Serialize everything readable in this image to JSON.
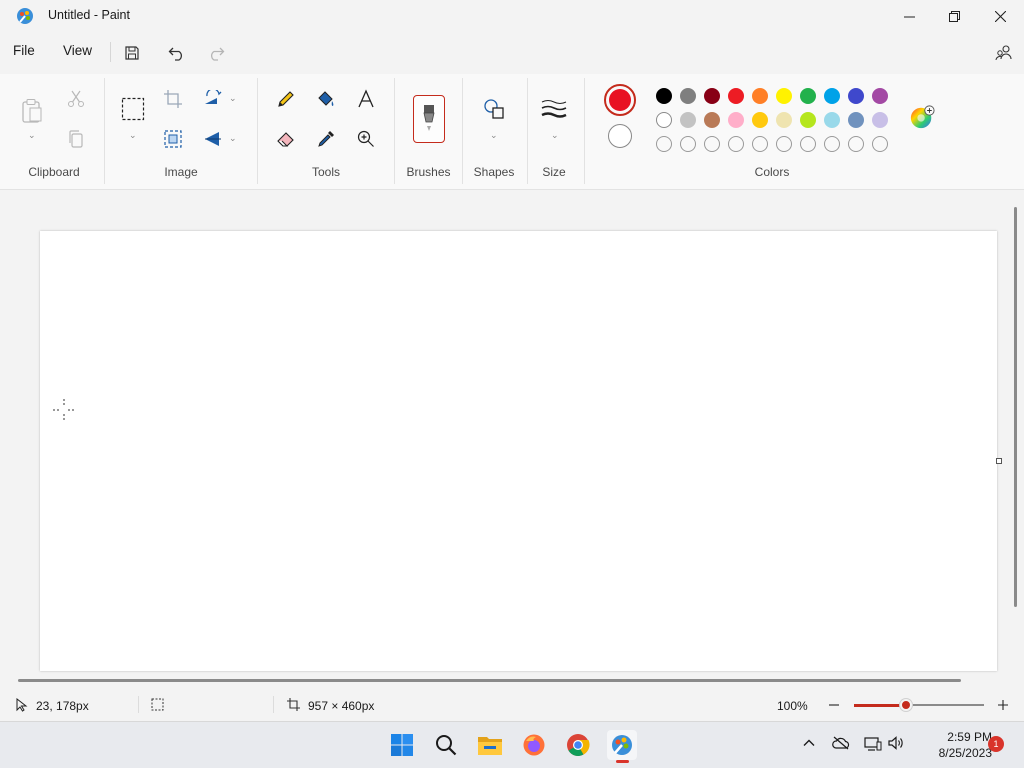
{
  "window": {
    "title": "Untitled - Paint"
  },
  "menu": {
    "file": "File",
    "view": "View"
  },
  "ribbon": {
    "groups": {
      "clipboard": "Clipboard",
      "image": "Image",
      "tools": "Tools",
      "brushes": "Brushes",
      "shapes": "Shapes",
      "size": "Size",
      "colors": "Colors"
    },
    "primary_color": "#e81123",
    "secondary_color": "#ffffff",
    "palette_row1": [
      "#000000",
      "#7f7f7f",
      "#880015",
      "#ed1c24",
      "#ff7f27",
      "#fff200",
      "#22b14c",
      "#00a2e8",
      "#3f48cc",
      "#a349a4"
    ],
    "palette_row2": [
      "#ffffff",
      "#c3c3c3",
      "#b97a57",
      "#ffaec9",
      "#ffc90e",
      "#efe4b0",
      "#b5e61d",
      "#99d9ea",
      "#7092be",
      "#c8bfe7"
    ]
  },
  "status": {
    "cursor_pos": "23, 178px",
    "canvas_size": "957 × 460px",
    "zoom": "100%"
  },
  "zoom_level_fraction": 0.4,
  "taskbar": {
    "time": "2:59 PM",
    "date": "8/25/2023",
    "notification_count": "1"
  }
}
